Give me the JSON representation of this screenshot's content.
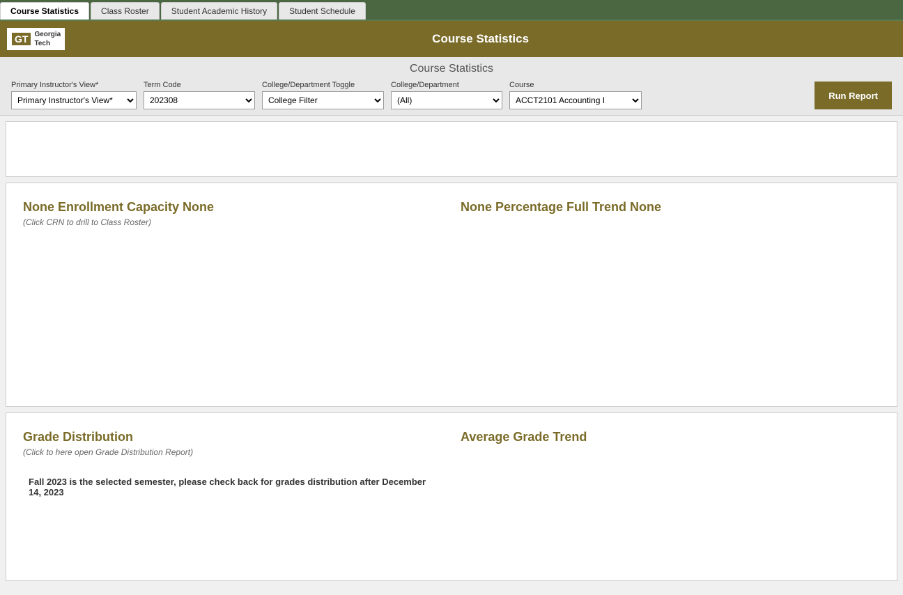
{
  "tabs": [
    {
      "id": "course-statistics",
      "label": "Course Statistics",
      "active": true
    },
    {
      "id": "class-roster",
      "label": "Class Roster",
      "active": false
    },
    {
      "id": "student-academic-history",
      "label": "Student Academic History",
      "active": false
    },
    {
      "id": "student-schedule",
      "label": "Student Schedule",
      "active": false
    }
  ],
  "header": {
    "logo_gt": "GT",
    "logo_name_line1": "Georgia",
    "logo_name_line2": "Tech",
    "title": "Course Statistics"
  },
  "filter": {
    "page_title": "Course Statistics",
    "primary_instructor_label": "Primary Instructor's View*",
    "primary_instructor_value": "Primary Instructor's View*",
    "term_code_label": "Term Code",
    "term_code_value": "202308",
    "college_dept_toggle_label": "College/Department Toggle",
    "college_dept_toggle_value": "College Filter",
    "college_dept_label": "College/Department",
    "college_dept_value": "(All)",
    "course_label": "Course",
    "course_value": "ACCT2101 Accounting I",
    "run_report_label": "Run Report"
  },
  "enrollment_section": {
    "title": "None Enrollment Capacity None",
    "subtitle": "(Click CRN to drill to Class Roster)"
  },
  "percentage_section": {
    "title": "None Percentage Full Trend None"
  },
  "grade_distribution": {
    "title": "Grade Distribution",
    "subtitle": "(Click to here open Grade Distribution Report)",
    "notice": "Fall 2023 is the selected semester, please check back for grades distribution after December 14, 2023"
  },
  "average_grade_trend": {
    "title": "Average Grade Trend"
  }
}
